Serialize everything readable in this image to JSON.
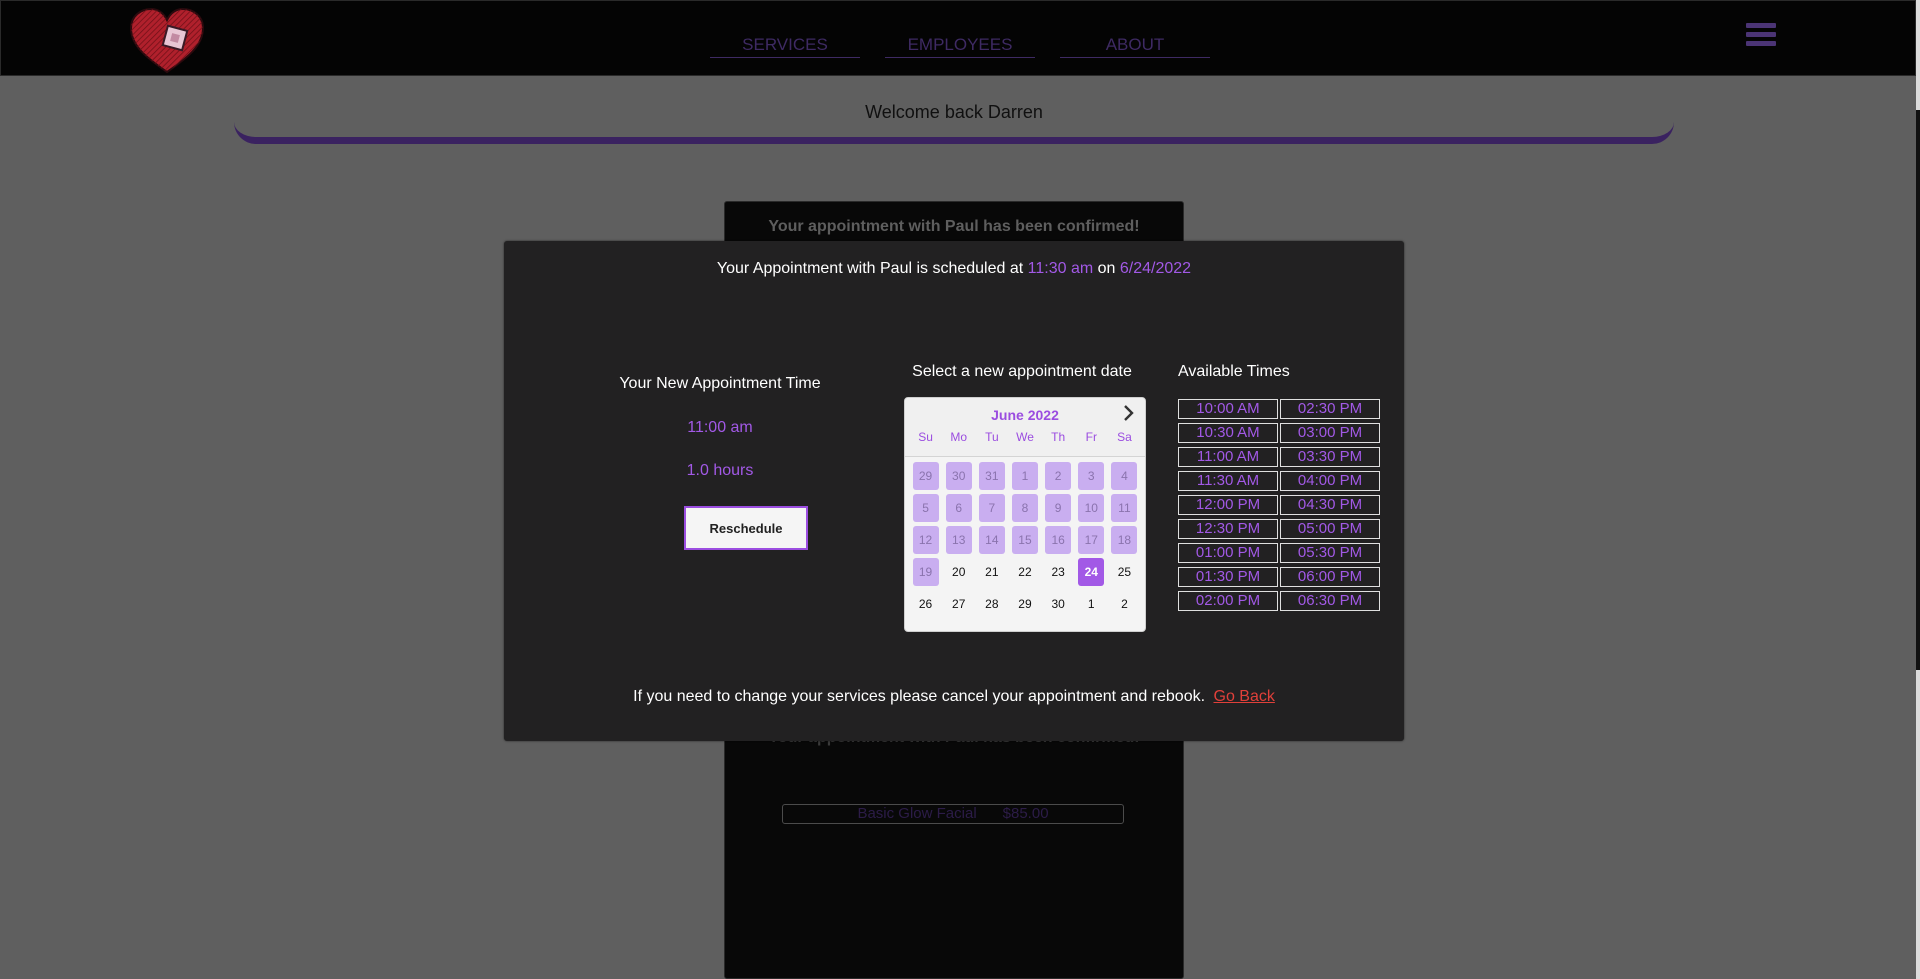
{
  "nav": {
    "items": [
      {
        "label": "SERVICES"
      },
      {
        "label": "EMPLOYEES"
      },
      {
        "label": "ABOUT"
      }
    ]
  },
  "welcome": {
    "text": "Welcome back Darren"
  },
  "background_card": {
    "heading": "Your appointment with Paul has been confirmed!",
    "heading_repeat": "Your appointment with Paul has been confirmed!",
    "service_name": "Basic Glow Facial",
    "service_price": "$85.00"
  },
  "modal": {
    "title_prefix": "Your Appointment with Paul is scheduled at",
    "scheduled_time": "11:30 am",
    "title_on": "on",
    "scheduled_date": "6/24/2022",
    "new_time_title": "Your New Appointment Time",
    "new_time": "11:00 am",
    "new_duration": "1.0 hours",
    "reschedule_label": "Reschedule",
    "calendar_title": "Select a new appointment date",
    "calendar": {
      "month": "June 2022",
      "weekdays": [
        "Su",
        "Mo",
        "Tu",
        "We",
        "Th",
        "Fr",
        "Sa"
      ],
      "days": [
        {
          "d": "29",
          "state": "disabled"
        },
        {
          "d": "30",
          "state": "disabled"
        },
        {
          "d": "31",
          "state": "disabled"
        },
        {
          "d": "1",
          "state": "disabled"
        },
        {
          "d": "2",
          "state": "disabled"
        },
        {
          "d": "3",
          "state": "disabled"
        },
        {
          "d": "4",
          "state": "disabled"
        },
        {
          "d": "5",
          "state": "disabled"
        },
        {
          "d": "6",
          "state": "disabled"
        },
        {
          "d": "7",
          "state": "disabled"
        },
        {
          "d": "8",
          "state": "disabled"
        },
        {
          "d": "9",
          "state": "disabled"
        },
        {
          "d": "10",
          "state": "disabled"
        },
        {
          "d": "11",
          "state": "disabled"
        },
        {
          "d": "12",
          "state": "disabled"
        },
        {
          "d": "13",
          "state": "disabled"
        },
        {
          "d": "14",
          "state": "disabled"
        },
        {
          "d": "15",
          "state": "disabled"
        },
        {
          "d": "16",
          "state": "disabled"
        },
        {
          "d": "17",
          "state": "disabled"
        },
        {
          "d": "18",
          "state": "disabled"
        },
        {
          "d": "19",
          "state": "disabled"
        },
        {
          "d": "20",
          "state": "normal"
        },
        {
          "d": "21",
          "state": "normal"
        },
        {
          "d": "22",
          "state": "normal"
        },
        {
          "d": "23",
          "state": "normal"
        },
        {
          "d": "24",
          "state": "selected"
        },
        {
          "d": "25",
          "state": "normal"
        },
        {
          "d": "26",
          "state": "normal"
        },
        {
          "d": "27",
          "state": "normal"
        },
        {
          "d": "28",
          "state": "normal"
        },
        {
          "d": "29",
          "state": "normal"
        },
        {
          "d": "30",
          "state": "normal"
        },
        {
          "d": "1",
          "state": "normal"
        },
        {
          "d": "2",
          "state": "normal"
        }
      ]
    },
    "times_title": "Available Times",
    "times": [
      "10:00 AM",
      "02:30 PM",
      "10:30 AM",
      "03:00 PM",
      "11:00 AM",
      "03:30 PM",
      "11:30 AM",
      "04:00 PM",
      "12:00 PM",
      "04:30 PM",
      "12:30 PM",
      "05:00 PM",
      "01:00 PM",
      "05:30 PM",
      "01:30 PM",
      "06:00 PM",
      "02:00 PM",
      "06:30 PM"
    ],
    "footer_text": "If you need to change your services please cancel your appointment and rebook.",
    "go_back_label": "Go Back"
  },
  "colors": {
    "accent": "#a259e6",
    "modal_bg": "#222122",
    "link_red": "#e0403a"
  }
}
